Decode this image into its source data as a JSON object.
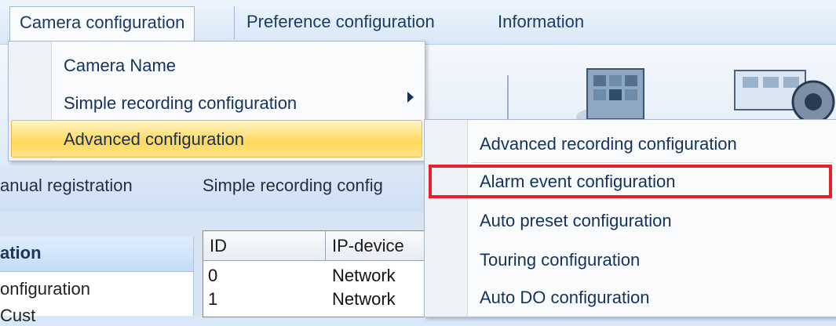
{
  "menubar": {
    "items": [
      "Camera configuration",
      "Preference configuration",
      "Information"
    ]
  },
  "camera_menu": {
    "items": [
      "Camera Name",
      "Simple recording configuration",
      "Advanced configuration"
    ],
    "highlighted": "Advanced configuration"
  },
  "advanced_submenu": {
    "items": [
      "Advanced recording configuration",
      "Alarm event configuration",
      "Auto preset configuration",
      "Touring configuration",
      "Auto DO configuration"
    ],
    "outlined": "Alarm event configuration",
    "outline_color": "#e8202a"
  },
  "toolbar": {
    "items": [
      "anual registration",
      "Simple recording config"
    ]
  },
  "left_panel": {
    "header": "ation",
    "rows": [
      "onfiguration",
      "Cust"
    ]
  },
  "device_grid": {
    "columns": [
      "ID",
      "IP-device"
    ],
    "rows": [
      {
        "id": "0",
        "device": "Network"
      },
      {
        "id": "1",
        "device": "Network"
      }
    ]
  },
  "colors": {
    "menu_highlight": "#ffd75a",
    "menu_text": "#13325d",
    "menubar_bg": "#d8e7f7"
  }
}
